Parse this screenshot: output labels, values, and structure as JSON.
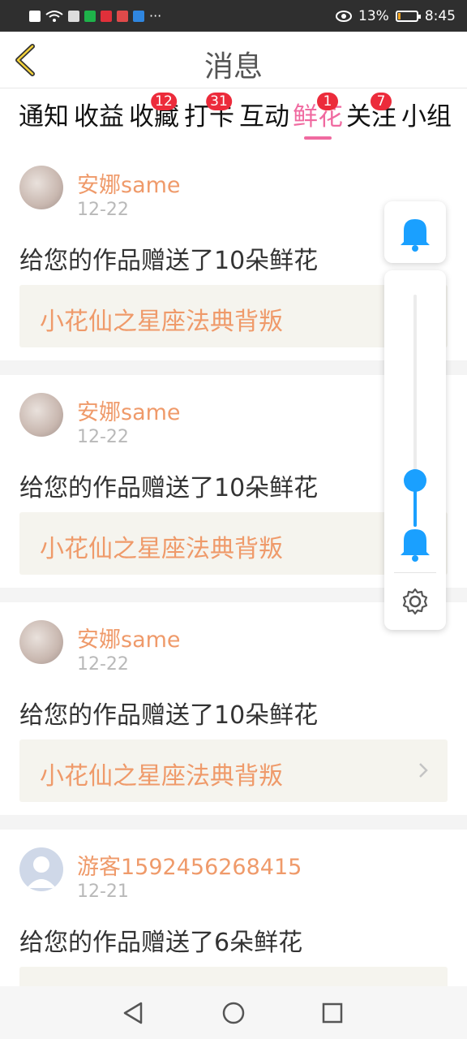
{
  "status_bar": {
    "battery": "13%",
    "time": "8:45",
    "battery_fraction": 0.13
  },
  "header": {
    "title": "消息"
  },
  "tabs": [
    {
      "label": "通知",
      "badge": ""
    },
    {
      "label": "收益",
      "badge": ""
    },
    {
      "label": "收藏",
      "badge": "12"
    },
    {
      "label": "打卡",
      "badge": "31"
    },
    {
      "label": "互动",
      "badge": ""
    },
    {
      "label": "鲜花",
      "badge": "1",
      "active": true
    },
    {
      "label": "关注",
      "badge": "7"
    },
    {
      "label": "小组",
      "badge": ""
    }
  ],
  "feed": {
    "items": [
      {
        "user": "安娜same",
        "date": "12-22",
        "message": "给您的作品赠送了10朵鲜花",
        "work": "小花仙之星座法典背叛"
      },
      {
        "user": "安娜same",
        "date": "12-22",
        "message": "给您的作品赠送了10朵鲜花",
        "work": "小花仙之星座法典背叛"
      },
      {
        "user": "安娜same",
        "date": "12-22",
        "message": "给您的作品赠送了10朵鲜花",
        "work": "小花仙之星座法典背叛"
      },
      {
        "user": "游客1592456268415",
        "date": "12-21",
        "message": "给您的作品赠送了6朵鲜花",
        "work": ""
      }
    ]
  },
  "volume_panel": {
    "level": 0.2,
    "colors": {
      "accent": "#1aa0ff"
    }
  },
  "colors": {
    "accent_pink": "#f06aa0",
    "name_orange": "#ef9a6a",
    "badge_red": "#ec2b3b"
  }
}
